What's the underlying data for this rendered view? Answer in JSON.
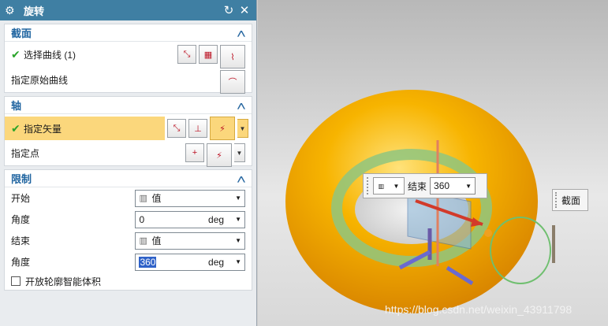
{
  "window": {
    "title": "旋转"
  },
  "section": {
    "title": "截面",
    "select_curve_label": "选择曲线 (1)",
    "specify_original_label": "指定原始曲线"
  },
  "axis": {
    "title": "轴",
    "specify_vector_label": "指定矢量",
    "specify_point_label": "指定点"
  },
  "limits": {
    "title": "限制",
    "start_label": "开始",
    "start_value": "值",
    "start_angle_label": "角度",
    "start_angle_value": "0",
    "end_label": "结束",
    "end_value": "值",
    "end_angle_label": "角度",
    "end_angle_value": "360",
    "unit": "deg",
    "open_profile_label": "开放轮廓智能体积"
  },
  "float_input": {
    "label": "结束",
    "value": "360"
  },
  "float_tag": {
    "label": "截面"
  },
  "watermark": "https://blog.csdn.net/weixin_43911798",
  "colors": {
    "titlebar": "#3f7fa3",
    "highlight": "#fbd77c",
    "torus": "#f5b400",
    "ring": "#6db86b"
  }
}
